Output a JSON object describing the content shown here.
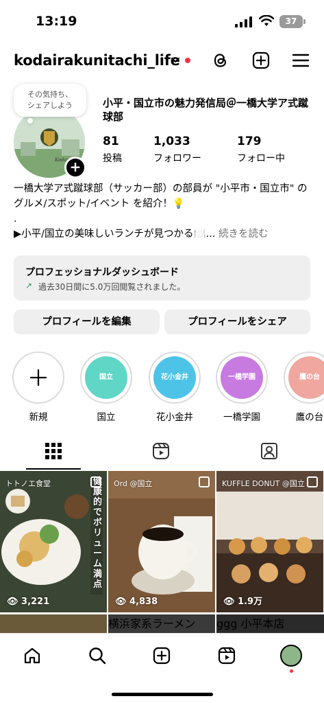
{
  "status_bar": {
    "time": "13:19",
    "battery": "37"
  },
  "header": {
    "username": "kodairakunitachi_life"
  },
  "note": {
    "text_line1": "その気持ち、",
    "text_line2": "シェアしよう"
  },
  "profile": {
    "display_name": "小平・国立市の魅力発信局＠一橋大学ア式蹴球部",
    "stats": [
      {
        "num": "81",
        "label": "投稿"
      },
      {
        "num": "1,033",
        "label": "フォロワー"
      },
      {
        "num": "179",
        "label": "フォロー中"
      }
    ],
    "bio_line1": "一橋大学ア式蹴球部（サッカー部）の部員が \"小平市・国立市\" の グルメ/スポット/イベント を紹介！💡",
    "bio_line2": ".",
    "bio_line3": "▶小平/国立の美味しいランチが見つかる🍽️...",
    "bio_more": "続きを読む"
  },
  "dashboard": {
    "title": "プロフェッショナルダッシュボード",
    "subtitle": "過去30日間に5.0万回閲覧されました。"
  },
  "buttons": {
    "edit": "プロフィールを編集",
    "share": "プロフィールをシェア"
  },
  "highlights": [
    {
      "label": "新規",
      "inner": ""
    },
    {
      "label": "国立",
      "inner": "国立",
      "color": "#5fd6c6"
    },
    {
      "label": "花小金井",
      "inner": "花小金井",
      "color": "#4dc3e8"
    },
    {
      "label": "一橋学園",
      "inner": "一橋学園",
      "color": "#c77be0"
    },
    {
      "label": "鷹の台",
      "inner": "鷹の台",
      "color": "#f0a7a0"
    }
  ],
  "posts": [
    {
      "caption": "トトノエ食堂",
      "views": "3,221",
      "side_text": "健康的でボリューム満点"
    },
    {
      "caption": "Ord @国立",
      "views": "4,838"
    },
    {
      "caption": "KUFFLE DONUT @国立",
      "views": "1.9万"
    }
  ],
  "row2_captions": [
    "",
    "横浜家系ラーメン",
    "ggg 小平本店"
  ]
}
